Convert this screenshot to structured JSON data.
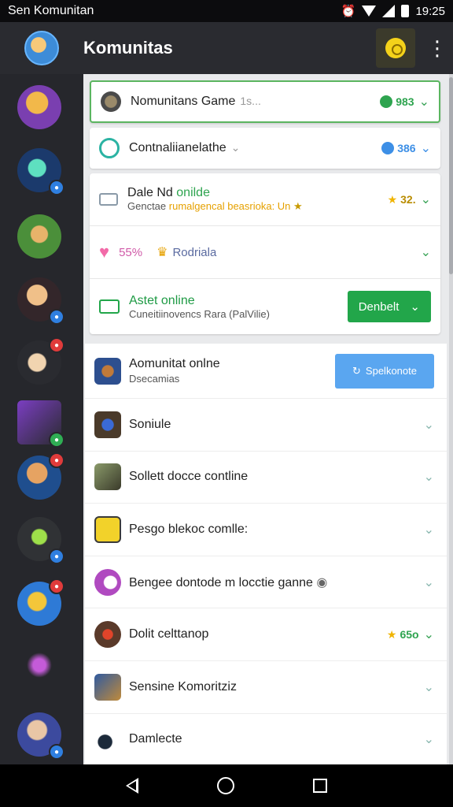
{
  "status_bar": {
    "app_name": "Sen Komunitan",
    "time": "19:25"
  },
  "app_bar": {
    "title": "Komunitas"
  },
  "top_cards": {
    "game_row": {
      "label": "Nomunitans Game",
      "secondary": "1s...",
      "count": "983"
    },
    "conn_row": {
      "label": "Contnaliianelathe",
      "count": "386"
    },
    "online_group": {
      "row1": {
        "title": "Dale",
        "title2": "Nd",
        "title3": "onilde",
        "subtitle": "Genctae",
        "subtitle2": "rumalgencal beasrioka: Un",
        "count": "32."
      },
      "row2": {
        "value": "55%",
        "label": "Rodriala"
      },
      "row3": {
        "title": "Astet online",
        "subtitle": "Cuneitiinovencs Rara (PalVilie)",
        "button": "Denbelt"
      }
    }
  },
  "list": [
    {
      "title": "Aomunitat onlne",
      "subtitle": "Dsecamias",
      "button": "Spelkonote"
    },
    {
      "title": "Soniule"
    },
    {
      "title": "Sollett docce contline"
    },
    {
      "title": "Pesgo blekoc comlle:"
    },
    {
      "title": "Bengee dontode m locctie ganne"
    },
    {
      "title": "Dolit celttanop",
      "count": "65o"
    },
    {
      "title": "Sensine Komoritziz"
    },
    {
      "title": "Damlecte"
    }
  ],
  "colors": {
    "accent_green": "#22a64a",
    "accent_blue": "#5aa6f0",
    "sidebar_bg": "#26272c",
    "appbar_bg": "#2a2b30"
  }
}
